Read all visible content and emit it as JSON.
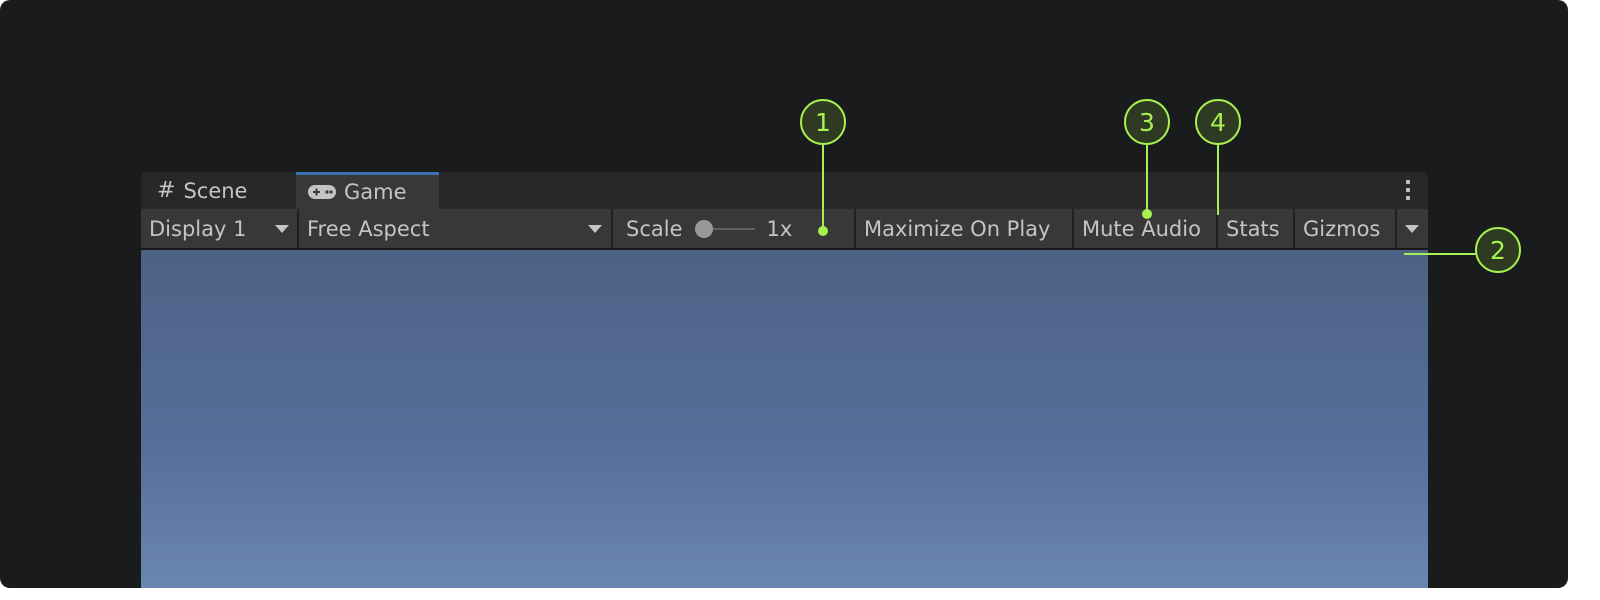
{
  "tabs": [
    {
      "label": "Scene",
      "icon": "grid-icon"
    },
    {
      "label": "Game",
      "icon": "gamepad-icon",
      "active": true
    }
  ],
  "toolbar": {
    "display": "Display 1",
    "aspect": "Free Aspect",
    "scale_label": "Scale",
    "scale_value": "1x",
    "maximize": "Maximize On Play",
    "mute": "Mute Audio",
    "stats": "Stats",
    "gizmos": "Gizmos"
  },
  "callouts": [
    "1",
    "2",
    "3",
    "4"
  ],
  "colors": {
    "accent": "#a6f04f",
    "active_tab": "#3a72b0",
    "viewport_top": "#4e6185",
    "viewport_bottom": "#6a86b2"
  }
}
